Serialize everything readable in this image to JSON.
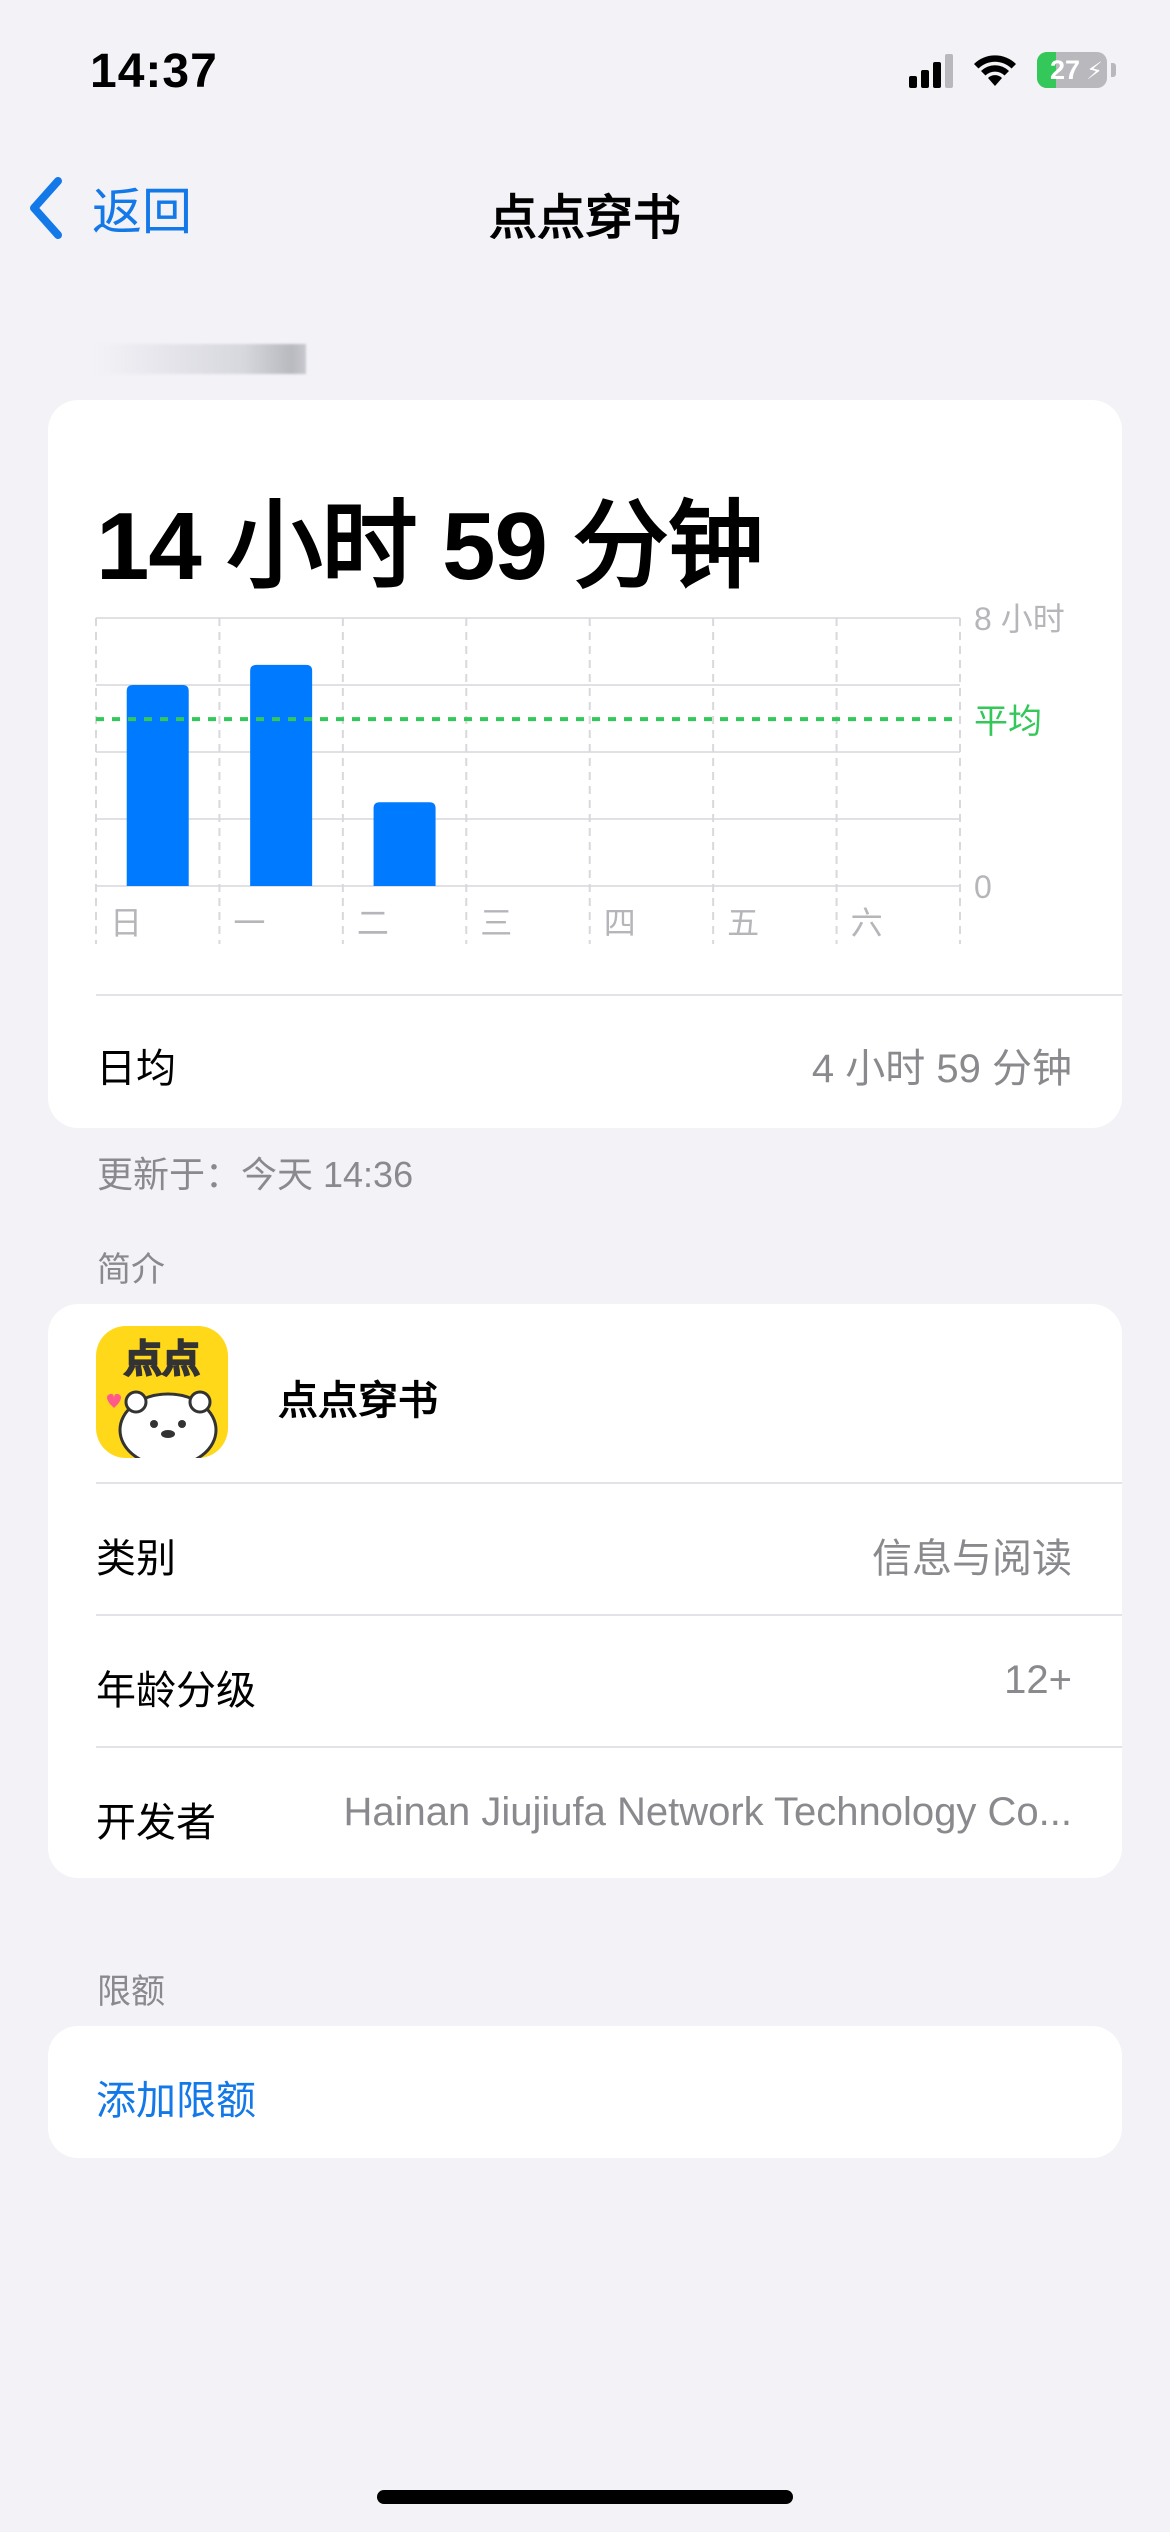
{
  "status_bar": {
    "time": "14:37",
    "battery_level": "27"
  },
  "nav": {
    "back_label": "返回",
    "title": "点点穿书"
  },
  "usage": {
    "total": "14 小时 59 分钟",
    "average_label": "日均",
    "average_value": "4 小时 59 分钟"
  },
  "chart_data": {
    "type": "bar",
    "categories": [
      "日",
      "一",
      "二",
      "三",
      "四",
      "五",
      "六"
    ],
    "values": [
      6.0,
      6.6,
      2.5,
      0,
      0,
      0,
      0
    ],
    "y_unit": "小时",
    "ylim": [
      0,
      8
    ],
    "y_tick_labels": [
      "0",
      "8 小时"
    ],
    "average_value": 4.98,
    "average_label": "平均",
    "bar_color": "#007AFF",
    "average_line_color": "#34C759",
    "grid": true
  },
  "updated_text": "更新于：今天 14:36",
  "info": {
    "section_title": "简介",
    "app_name": "点点穿书",
    "app_icon_text": "点点",
    "rows": [
      {
        "key": "类别",
        "value": "信息与阅读"
      },
      {
        "key": "年龄分级",
        "value": "12+"
      },
      {
        "key": "开发者",
        "value": "Hainan Jiujiufa Network Technology Co..."
      }
    ]
  },
  "limits": {
    "section_title": "限额",
    "add_label": "添加限额"
  }
}
